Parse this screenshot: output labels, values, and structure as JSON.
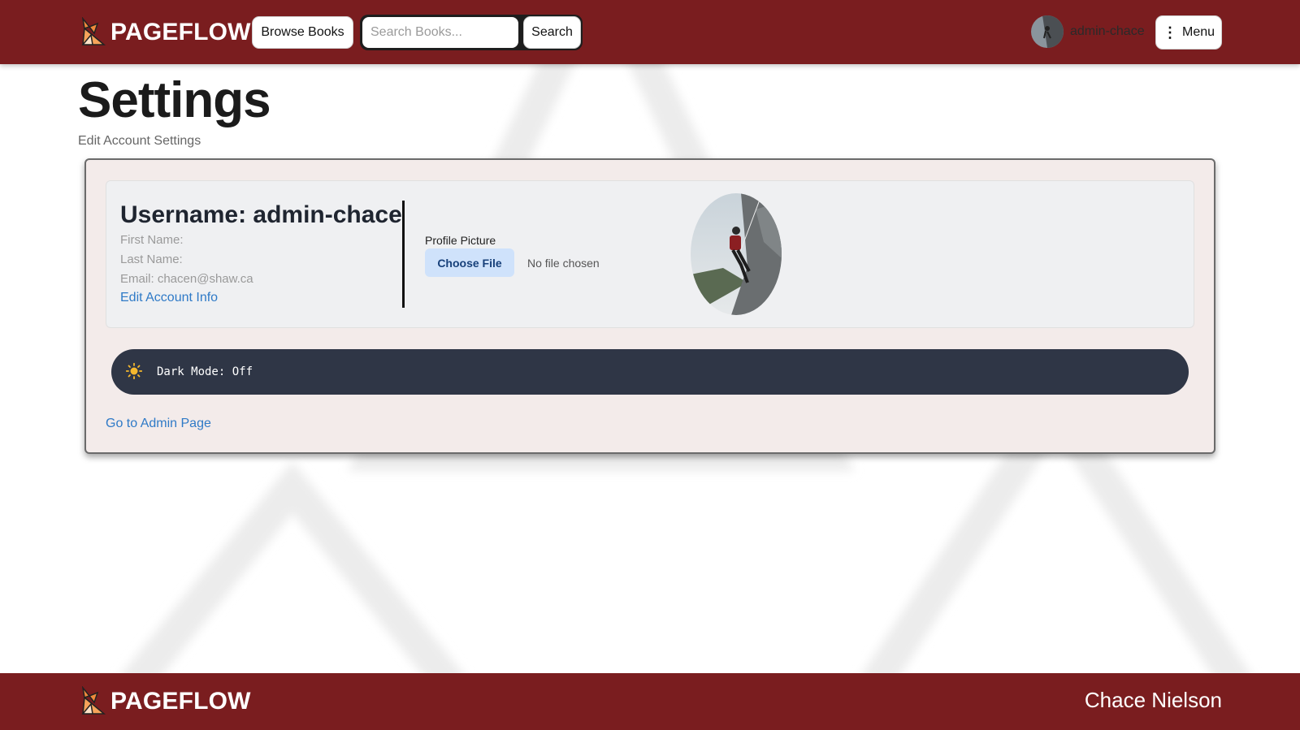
{
  "header": {
    "brand": "PAGEFLOW",
    "browse_label": "Browse Books",
    "search_placeholder": "Search Books...",
    "search_label": "Search",
    "username": "admin-chace",
    "menu_label": "Menu"
  },
  "page": {
    "title": "Settings",
    "subtitle": "Edit Account Settings"
  },
  "account": {
    "username_line": "Username: admin-chace",
    "first_name": "First Name:",
    "last_name": "Last Name:",
    "email": "Email: chacen@shaw.ca",
    "edit_link": "Edit Account Info",
    "profile_picture_label": "Profile Picture",
    "choose_file_label": "Choose File",
    "no_file_text": "No file chosen"
  },
  "dark_mode": {
    "label": "Dark Mode: Off",
    "icon": "sun-icon"
  },
  "admin_link": "Go to Admin Page",
  "footer": {
    "brand": "PAGEFLOW",
    "author": "Chace Nielson"
  },
  "colors": {
    "brand_red": "#7a1d1f",
    "link_blue": "#2f7ac7",
    "toggle_bg": "#2f3646"
  }
}
